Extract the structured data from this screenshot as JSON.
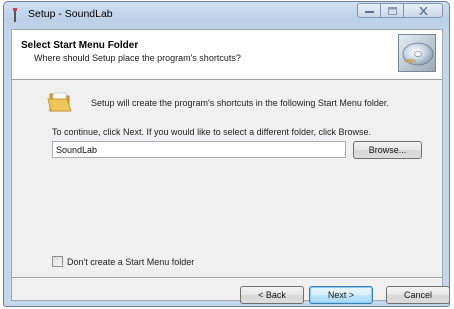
{
  "window": {
    "title": "Setup - SoundLab",
    "controls": {
      "minimize_icon": "minimize-icon",
      "maximize_icon": "maximize-icon",
      "close_icon": "close-icon"
    }
  },
  "header": {
    "title": "Select Start Menu Folder",
    "subtitle": "Where should Setup place the program's shortcuts?"
  },
  "body": {
    "intro": "Setup will create the program's shortcuts in the following Start Menu folder.",
    "instruction": "To continue, click Next. If you would like to select a different folder, click Browse.",
    "folder_value": "SoundLab",
    "browse_label": "Browse...",
    "no_folder_label": "Don't create a Start Menu folder",
    "no_folder_checked": false
  },
  "footer": {
    "back_label": "< Back",
    "next_label": "Next >",
    "cancel_label": "Cancel"
  },
  "colors": {
    "accent": "#3c7fb1",
    "frame": "#bcd0e8"
  }
}
